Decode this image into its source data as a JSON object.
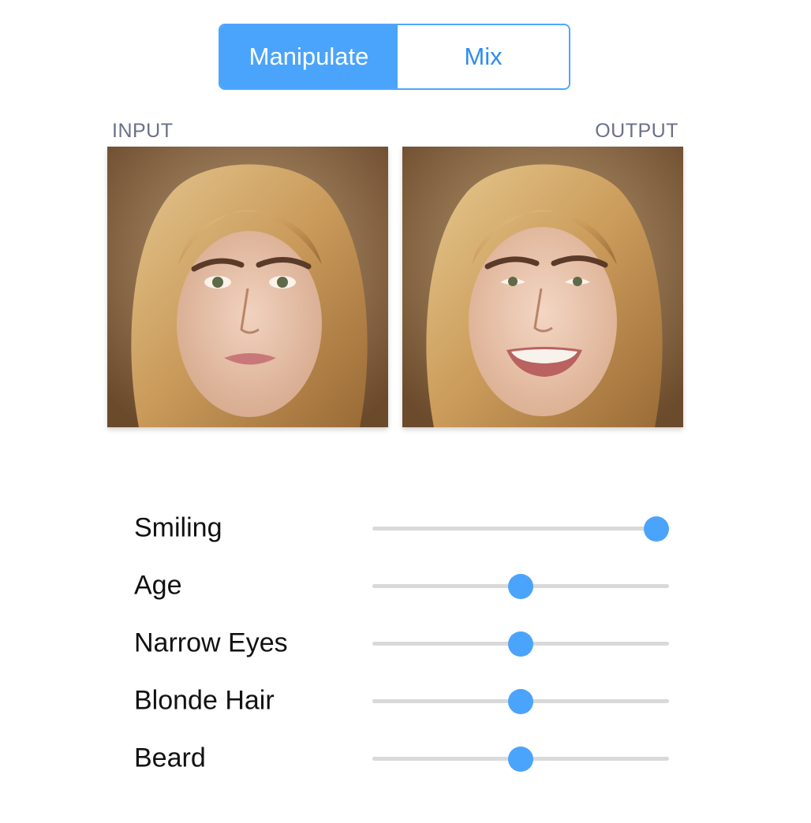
{
  "mode_toggle": {
    "manipulate_label": "Manipulate",
    "mix_label": "Mix",
    "active": "Manipulate"
  },
  "images": {
    "input_label": "INPUT",
    "output_label": "OUTPUT"
  },
  "colors": {
    "accent": "#4ba4fb",
    "track": "#d9d9d9",
    "label_gray": "#6a7088"
  },
  "sliders": [
    {
      "label": "Smiling",
      "value": 1.0
    },
    {
      "label": "Age",
      "value": 0.5
    },
    {
      "label": "Narrow Eyes",
      "value": 0.5
    },
    {
      "label": "Blonde Hair",
      "value": 0.5
    },
    {
      "label": "Beard",
      "value": 0.5
    }
  ]
}
